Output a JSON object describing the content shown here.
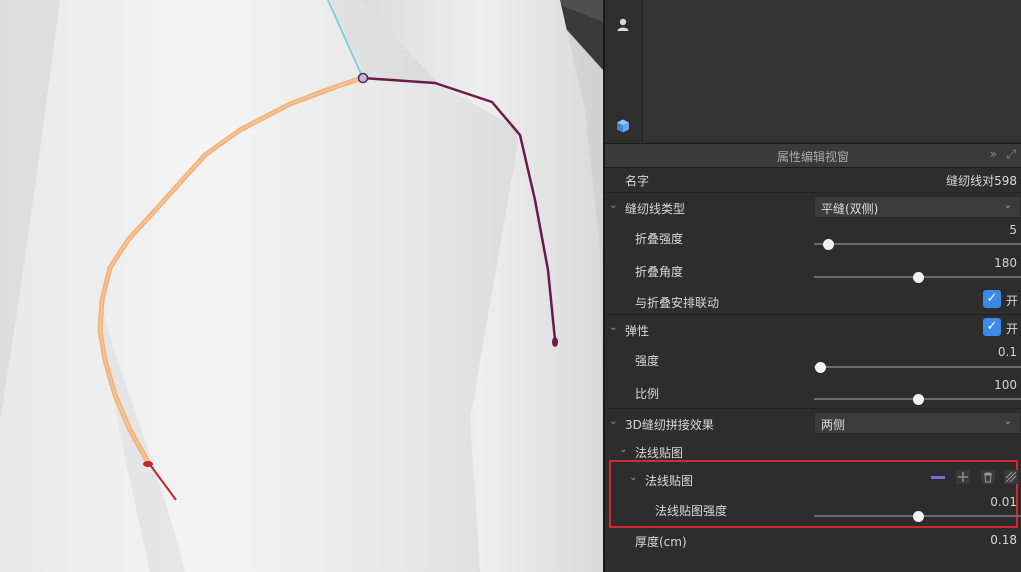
{
  "panel": {
    "title": "属性编辑视窗",
    "collapse_icon": "»",
    "expand_icon": "⤢"
  },
  "properties": {
    "name_label": "名字",
    "name_value": "缝纫线对598",
    "seam_type_label": "缝纫线类型",
    "seam_type_value": "平缝(双侧)",
    "fold_strength_label": "折叠强度",
    "fold_strength_value": "5",
    "fold_angle_label": "折叠角度",
    "fold_angle_value": "180",
    "fold_link_label": "与折叠安排联动",
    "fold_link_toggle": "开",
    "elastic_label": "弹性",
    "elastic_toggle": "开",
    "strength_label": "强度",
    "strength_value": "0.1",
    "ratio_label": "比例",
    "ratio_value": "100",
    "stitch3d_label": "3D缝纫拼接效果",
    "stitch3d_value": "两侧",
    "normal_map_group_label": "法线贴图",
    "normal_map_label": "法线贴图",
    "normal_map_strength_label": "法线贴图强度",
    "normal_map_strength_value": "0.01",
    "thickness_label": "厚度(cm)",
    "thickness_value": "0.18"
  },
  "slider_levels": {
    "fold_strength": 0.07,
    "fold_angle": 0.5,
    "strength": 0.03,
    "ratio": 0.5,
    "normal_map_strength": 0.5
  },
  "icons": {
    "toolbar": [
      "avatar-icon",
      "cube-icon"
    ],
    "normal_map_actions": [
      "color-swatch-icon",
      "add-icon",
      "delete-icon",
      "texture-icon"
    ]
  },
  "colors": {
    "accent": "#3d8ae6",
    "highlight": "#d32b2b",
    "seam_orange": "#f2b27a",
    "seam_purple": "#6b1a4a",
    "seam_cyan": "#7fd0dc",
    "seam_red": "#c0282c"
  }
}
